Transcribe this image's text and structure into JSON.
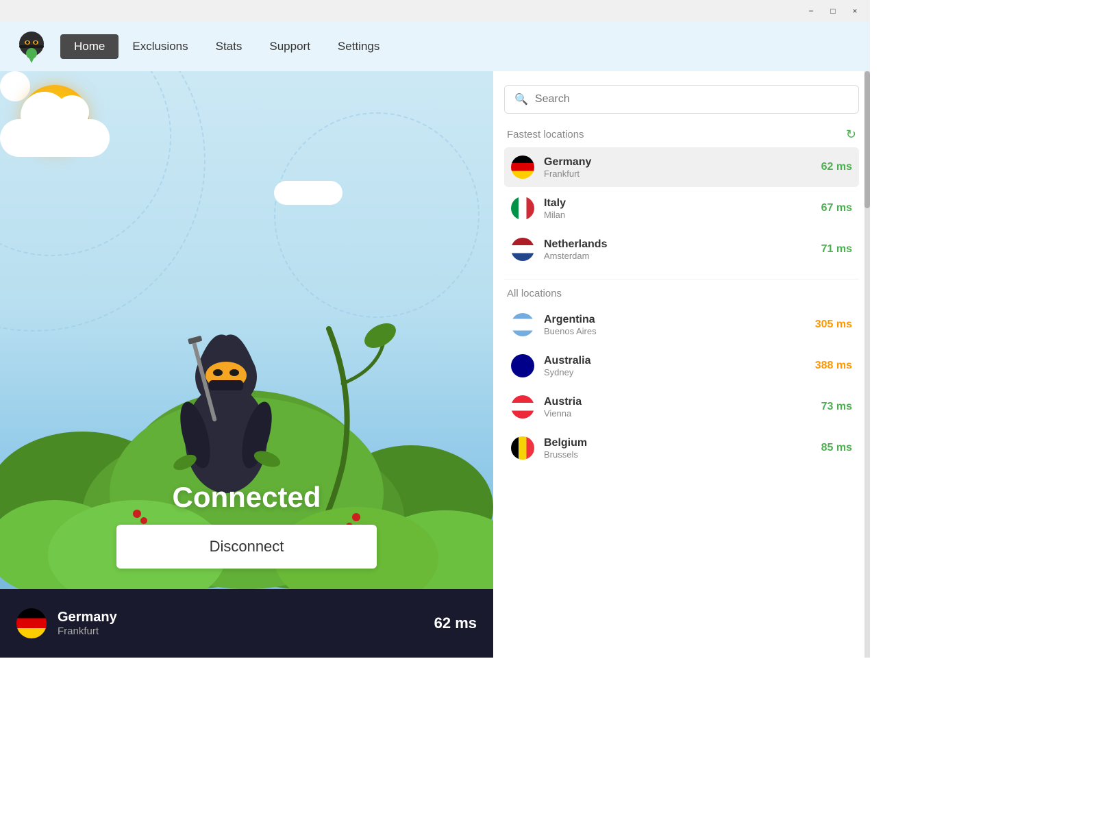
{
  "titlebar": {
    "minimize_label": "−",
    "maximize_label": "□",
    "close_label": "×"
  },
  "navbar": {
    "tabs": [
      {
        "id": "home",
        "label": "Home",
        "active": true
      },
      {
        "id": "exclusions",
        "label": "Exclusions",
        "active": false
      },
      {
        "id": "stats",
        "label": "Stats",
        "active": false
      },
      {
        "id": "support",
        "label": "Support",
        "active": false
      },
      {
        "id": "settings",
        "label": "Settings",
        "active": false
      }
    ]
  },
  "left_panel": {
    "status": "Connected",
    "disconnect_label": "Disconnect",
    "current_location": {
      "country": "Germany",
      "city": "Frankfurt",
      "ping": "62 ms"
    }
  },
  "right_panel": {
    "search": {
      "placeholder": "Search"
    },
    "fastest_locations": {
      "title": "Fastest locations",
      "items": [
        {
          "country": "Germany",
          "city": "Frankfurt",
          "ping": "62 ms",
          "ping_class": "ping-green",
          "flag": "🇩🇪",
          "selected": true
        },
        {
          "country": "Italy",
          "city": "Milan",
          "ping": "67 ms",
          "ping_class": "ping-green",
          "flag": "🇮🇹",
          "selected": false
        },
        {
          "country": "Netherlands",
          "city": "Amsterdam",
          "ping": "71 ms",
          "ping_class": "ping-green",
          "flag": "🇳🇱",
          "selected": false
        }
      ]
    },
    "all_locations": {
      "title": "All locations",
      "items": [
        {
          "country": "Argentina",
          "city": "Buenos Aires",
          "ping": "305 ms",
          "ping_class": "ping-orange",
          "flag": "🇦🇷",
          "selected": false
        },
        {
          "country": "Australia",
          "city": "Sydney",
          "ping": "388 ms",
          "ping_class": "ping-orange",
          "flag": "🇦🇺",
          "selected": false
        },
        {
          "country": "Austria",
          "city": "Vienna",
          "ping": "73 ms",
          "ping_class": "ping-green",
          "flag": "🇦🇹",
          "selected": false
        },
        {
          "country": "Belgium",
          "city": "Brussels",
          "ping": "85 ms",
          "ping_class": "ping-green",
          "flag": "🇧🇪",
          "selected": false
        }
      ]
    }
  }
}
